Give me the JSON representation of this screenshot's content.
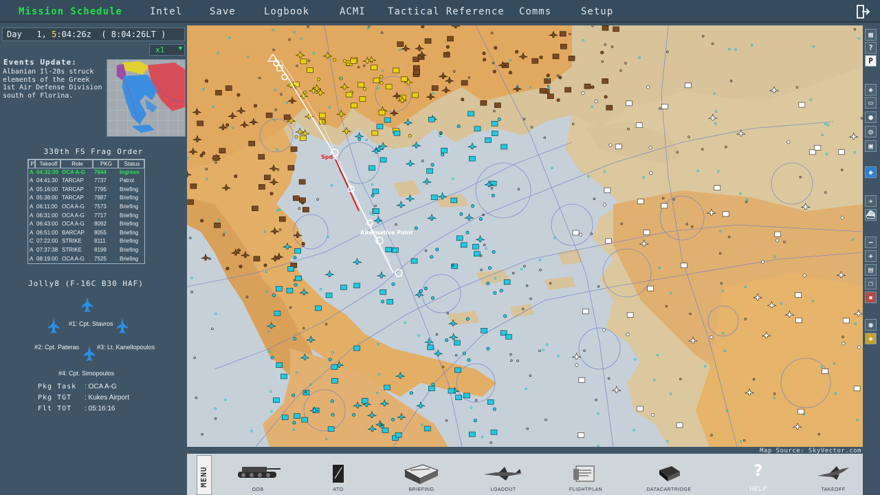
{
  "menu": {
    "items": [
      {
        "label": "Mission Schedule",
        "active": true
      },
      {
        "label": "Intel"
      },
      {
        "label": "Save"
      },
      {
        "label": "Logbook"
      },
      {
        "label": "ACMI"
      },
      {
        "label": "Tactical Reference"
      },
      {
        "label": "Comms"
      },
      {
        "label": "Setup"
      }
    ],
    "exit_icon": "exit-door-icon"
  },
  "clock": {
    "day_label": "Day",
    "day_num": "1,",
    "hour": "5",
    "time_z": ":04:26",
    "z": "z",
    "lt": "( 8:04:26",
    "lt_suffix": "LT",
    "lt_close": ")"
  },
  "speed": {
    "value": "x1"
  },
  "events": {
    "title": "Events Update:",
    "text": "Albanian Il-28s struck elements of the Greek 1st Air Defense Division south of Florina."
  },
  "frag": {
    "title": "330th FS Frag Order",
    "headers": [
      "P",
      "Takeoff",
      "Role",
      "PKG",
      "Status"
    ],
    "rows": [
      [
        "A",
        "04:32:00",
        "OCA A-G",
        "7844",
        "Ingress"
      ],
      [
        "A",
        "04:41:30",
        "TARCAP",
        "7737",
        "Patrol"
      ],
      [
        "A",
        "05:16:00",
        "TARCAP",
        "7795",
        "Briefing"
      ],
      [
        "A",
        "05:38:00",
        "TARCAP",
        "7887",
        "Briefing"
      ],
      [
        "A",
        "06:11:00",
        "OCA A-G",
        "7573",
        "Briefing"
      ],
      [
        "A",
        "06:31:00",
        "OCA A-G",
        "7717",
        "Briefing"
      ],
      [
        "A",
        "06:43:00",
        "OCA A-G",
        "8092",
        "Briefing"
      ],
      [
        "A",
        "06:51:00",
        "BARCAP",
        "8055",
        "Briefing"
      ],
      [
        "C",
        "07:22:00",
        "STRIKE",
        "8111",
        "Briefing"
      ],
      [
        "A",
        "07:37:38",
        "STRIKE",
        "8199",
        "Briefing"
      ],
      [
        "A",
        "08:19:00",
        "OCA A-G",
        "7525",
        "Briefing"
      ]
    ],
    "selected_row": 0
  },
  "flight": {
    "title": "Jolly8 (F-16C B30 HAF)",
    "pilots": [
      "#1: Cpt. Stavros",
      "#2: Cpt. Pateras",
      "#3: Lt. Kanellopoulos",
      "#4: Cpt. Simopoulos"
    ]
  },
  "package": {
    "task_label": "Pkg Task",
    "task_value": ": OCA A-G",
    "tgt_label": "Pkg TGT",
    "tgt_value": ": Kukes Airport",
    "tot_label": "Flt TOT",
    "tot_value": ": 05:16:16"
  },
  "map": {
    "labels": {
      "ip": "Alternative Point",
      "sp": "Spd"
    },
    "source": "Map Source: SkyVector.com"
  },
  "right_tools": [
    "layers-icon",
    "help-icon",
    "p-icon",
    "cube-icon",
    "page-icon",
    "drop-icon",
    "sat-icon",
    "grid-icon",
    "blue-icon",
    "air-icon",
    "ship-icon",
    "zoom-out-icon",
    "zoom-in-icon",
    "page2-icon",
    "copy-icon",
    "redbox-icon",
    "radar-icon",
    "star-icon"
  ],
  "right_labels": {
    "help": "?",
    "p": "P"
  },
  "bottom": {
    "menu_label": "MENU",
    "buttons": [
      "OOB",
      "ATO",
      "BRIEFING",
      "LOADOUT",
      "FLIGHTPLAN",
      "DATACARTRIDGE",
      "HELP",
      "TAKEOFF"
    ],
    "help_glyph": "?"
  },
  "colors": {
    "accent_green": "#22e04a",
    "panel": "#3f5566",
    "friendly": "#22c8e0",
    "enemy": "#e8d010",
    "hostile_brown": "#7a4a22"
  }
}
